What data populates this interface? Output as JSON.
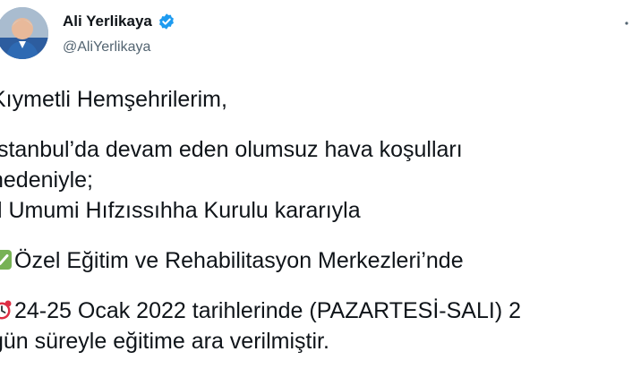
{
  "author": {
    "display_name": "Ali Yerlikaya",
    "handle": "@AliYerlikaya",
    "verified": true,
    "avatar_icon": "profile-photo"
  },
  "tweet": {
    "lines": [
      "Kıymetli Hemşehrilerim,",
      "İstanbul’da devam eden olumsuz hava koşulları",
      "nedeniyle;",
      "İl Umumi Hıfzıssıhha Kurulu kararıyla",
      "Özel Eğitim ve Rehabilitasyon Merkezleri’nde",
      "24-25 Ocak 2022 tarihlerinde (PAZARTESİ-SALI) 2",
      "gün süreyle eğitime ara verilmiştir."
    ],
    "emoji": {
      "check": "white-check-mark-emoji",
      "clock": "alarm-clock-emoji"
    }
  },
  "colors": {
    "verified_blue": "#1d9bf0",
    "text": "#0f1419",
    "secondary_text": "#536471",
    "check_green": "#77b255",
    "clock_red": "#dd2e44"
  }
}
